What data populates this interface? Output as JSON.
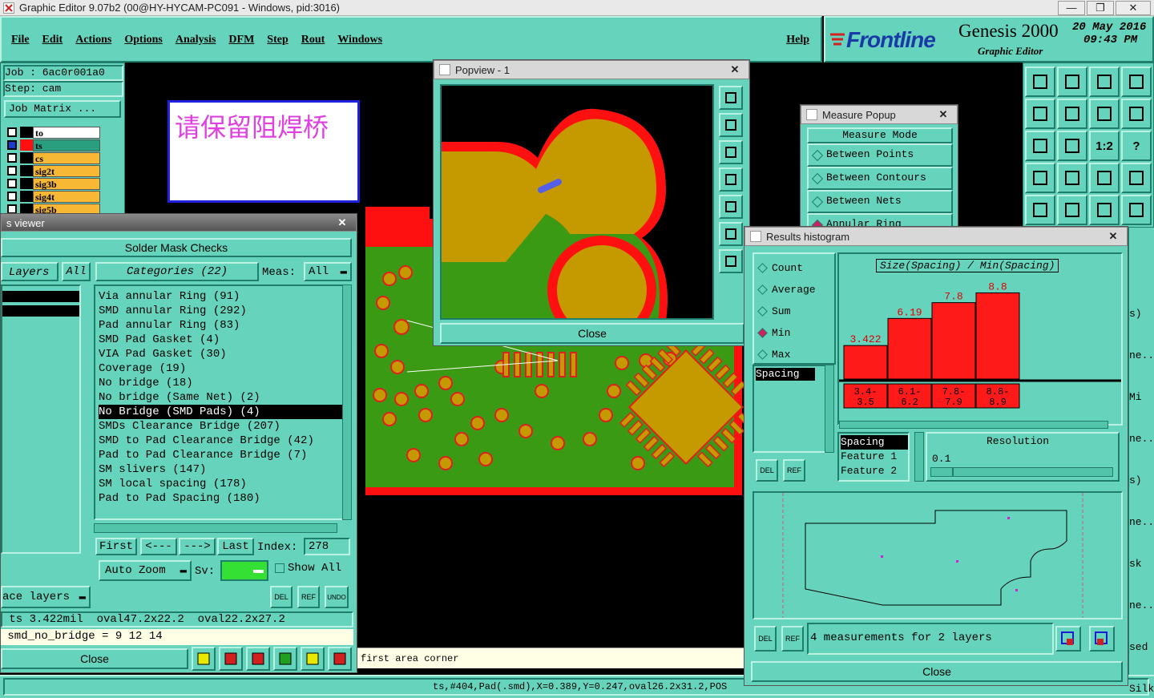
{
  "window_title": "Graphic Editor 9.07b2 (00@HY-HYCAM-PC091 - Windows, pid:3016)",
  "menu": [
    "File",
    "Edit",
    "Actions",
    "Options",
    "Analysis",
    "DFM",
    "Step",
    "Rout",
    "Windows"
  ],
  "help_label": "Help",
  "brand": {
    "logo": "Frontline",
    "product": "Genesis 2000",
    "subtitle": "Graphic Editor",
    "date": "20 May 2016",
    "time": "09:43 PM"
  },
  "job_panel": {
    "job": "Job  :  6ac0r001a0",
    "step": "Step: cam",
    "matrix_button": "Job Matrix ...",
    "layers": [
      {
        "name": "to",
        "color": "#ffffff"
      },
      {
        "name": "ts",
        "color": "#2a9f7f"
      },
      {
        "name": "cs",
        "color": "#f7b836"
      },
      {
        "name": "sig2t",
        "color": "#f7b836"
      },
      {
        "name": "sig3b",
        "color": "#f7b836"
      },
      {
        "name": "sig4t",
        "color": "#f7b836"
      },
      {
        "name": "sig5b",
        "color": "#f7b836"
      }
    ]
  },
  "annotation_text": "请保留阻焊桥",
  "checks_viewer": {
    "title": "s viewer",
    "heading": "Solder Mask Checks",
    "layers_label": "Layers",
    "all_label": "All",
    "categories_label": "Categories (22)",
    "meas_label": "Meas:",
    "meas_value": "All",
    "categories": [
      "Via annular Ring (91)",
      "SMD annular Ring (292)",
      "Pad annular Ring (83)",
      "SMD Pad Gasket (4)",
      "VIA Pad Gasket (30)",
      "Coverage (19)",
      "No bridge (18)",
      "No bridge (Same Net) (2)",
      "No Bridge (SMD Pads) (4)",
      "SMDs Clearance Bridge (207)",
      "SMD to Pad Clearance Bridge (42)",
      "Pad to Pad Clearance Bridge (7)",
      "SM slivers (147)",
      "SM local spacing (178)",
      "Pad to Pad Spacing (180)"
    ],
    "selected_index": 8,
    "nav": {
      "first": "First",
      "prev": "<---",
      "next": "--->",
      "last": "Last",
      "index_label": "Index:",
      "index_value": "278"
    },
    "auto_zoom": "Auto Zoom",
    "sv_label": "Sv:",
    "show_all": "Show All",
    "face_layers": "ace layers",
    "btn_del": "DEL",
    "btn_ref": "REF",
    "btn_undo": "UNDO",
    "status1": " ts 3.422mil  oval47.2x22.2  oval22.2x27.2",
    "status2": " smd_no_bridge = 9 12 14",
    "close": "Close"
  },
  "prompt_text": "first area corner",
  "status_bar": "ts,#404,Pad(.smd),X=0.389,Y=0.247,oval26.2x31.2,POS",
  "popview": {
    "title": "Popview - 1",
    "close": "Close"
  },
  "measure_popup": {
    "title": "Measure Popup",
    "mode_label": "Measure Mode",
    "options": [
      "Between Points",
      "Between Contours",
      "Between Nets",
      "Annular Ring"
    ],
    "selected": 3
  },
  "histogram": {
    "title": "Results histogram",
    "stats": [
      "Count",
      "Average",
      "Sum",
      "Min",
      "Max"
    ],
    "selected_stat": 3,
    "list_item": "Spacing",
    "chart_title": "Size(Spacing) / Min(Spacing)",
    "resolution_label": "Resolution",
    "resolution_value": "0.1",
    "detail_items": [
      "Spacing",
      "Feature 1",
      "Feature 2"
    ],
    "measurements": "4 measurements for 2 layers",
    "close": "Close",
    "del": "DEL",
    "ref": "REF"
  },
  "right_side_fragments": [
    "s)",
    "ne...",
    "Mi",
    "ne...",
    "s)",
    "ne...",
    "sk",
    "ne...",
    "sed",
    "Silkscreen"
  ],
  "chart_data": {
    "type": "bar",
    "title": "Size(Spacing) / Min(Spacing)",
    "categories": [
      "3.4-3.5",
      "6.1-6.2",
      "7.8-7.9",
      "8.8-8.9"
    ],
    "values": [
      3.422,
      6.19,
      7.8,
      8.8
    ],
    "data_labels": [
      "3.422",
      "6.19",
      "7.8",
      "8.8"
    ],
    "color": "#ff1a1a"
  },
  "colors": {
    "teal": "#66d4bc",
    "pad": "#c49a00",
    "mask": "#ff1010",
    "board": "#3a9a14"
  }
}
